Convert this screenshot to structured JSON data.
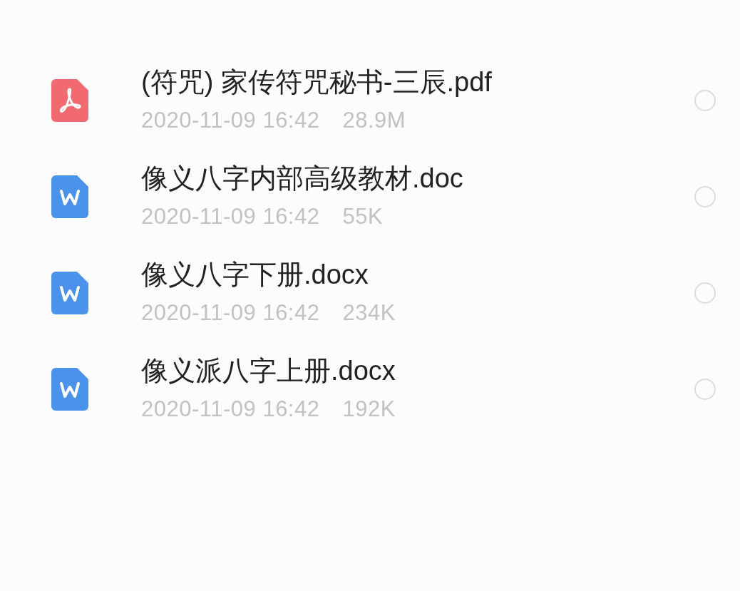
{
  "files": [
    {
      "kind": "pdf",
      "name": "(符咒) 家传符咒秘书-三辰.pdf",
      "date": "2020-11-09 16:42",
      "size": "28.9M",
      "selected": false
    },
    {
      "kind": "word",
      "name": "像义八字内部高级教材.doc",
      "date": "2020-11-09 16:42",
      "size": "55K",
      "selected": false
    },
    {
      "kind": "word",
      "name": "像义八字下册.docx",
      "date": "2020-11-09 16:42",
      "size": "234K",
      "selected": false
    },
    {
      "kind": "word",
      "name": "像义派八字上册.docx",
      "date": "2020-11-09 16:42",
      "size": "192K",
      "selected": false
    }
  ]
}
